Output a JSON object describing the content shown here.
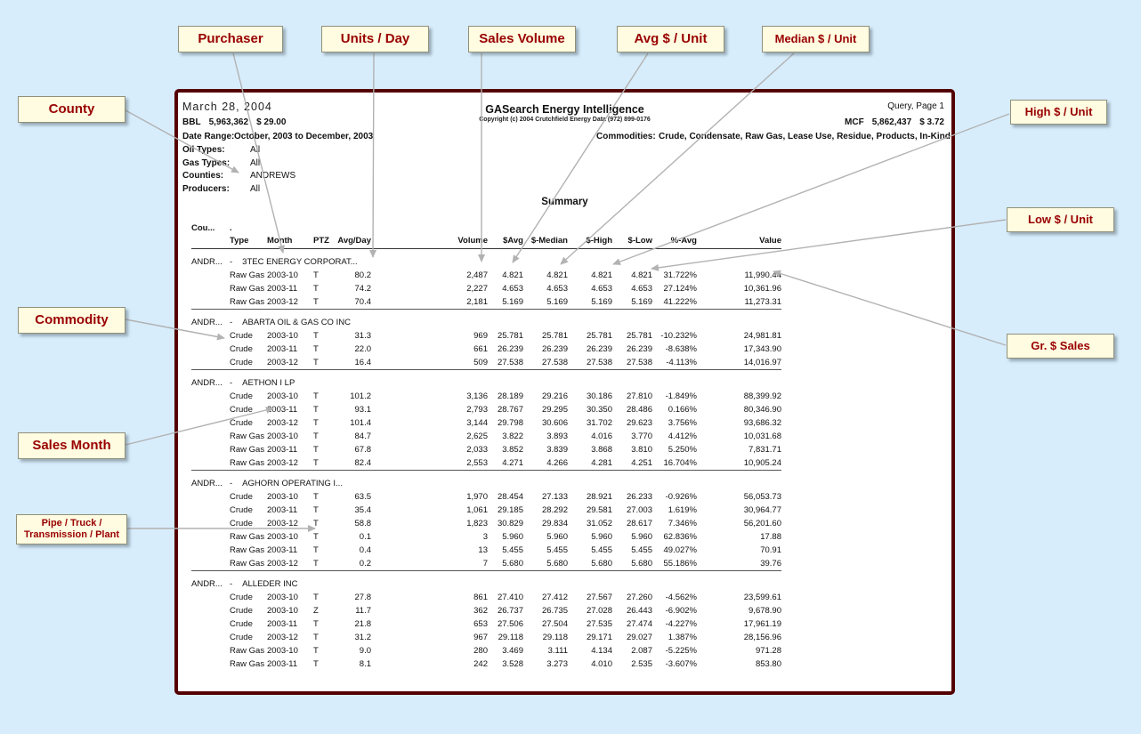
{
  "callouts": {
    "purchaser": "Purchaser",
    "units_day": "Units / Day",
    "sales_volume": "Sales Volume",
    "avg_unit": "Avg $ / Unit",
    "median_unit": "Median $ / Unit",
    "county": "County",
    "high_unit": "High $ / Unit",
    "low_unit": "Low $ / Unit",
    "commodity": "Commodity",
    "gr_sales": "Gr. $ Sales",
    "sales_month": "Sales Month",
    "ptz": "Pipe / Truck / Transmission / Plant"
  },
  "report": {
    "date": "March 28, 2004",
    "bbl": {
      "label": "BBL",
      "volume": "5,963,362",
      "price": "$ 29.00"
    },
    "mcf": {
      "label": "MCF",
      "volume": "5,862,437",
      "price": "$ 3.72"
    },
    "title": "GASearch Energy Intelligence",
    "copyright": "Copyright (c) 2004 Crutchfield Energy Data  (972) 899-0176",
    "query_page": "Query, Page 1",
    "date_range_label": "Date Range:",
    "date_range_value": "October, 2003 to December, 2003",
    "commodities_label": "Commodities:",
    "commodities_value": "Crude, Condensate, Raw Gas, Lease Use, Residue, Products, In-Kind",
    "filters": [
      {
        "label": "Oil Types:",
        "value": "All"
      },
      {
        "label": "Gas Types:",
        "value": "All"
      },
      {
        "label": "Counties:",
        "value": "ANDREWS"
      },
      {
        "label": "Producers:",
        "value": "All"
      }
    ],
    "section_title": "Summary"
  },
  "table": {
    "county_header": "Cou...",
    "dot": ".",
    "columns": [
      "Type",
      "Month",
      "PTZ",
      "Avg/Day",
      "Volume",
      "$Avg",
      "$-Median",
      "$-High",
      "$-Low",
      "%-Avg",
      "Value"
    ],
    "groups": [
      {
        "county": "ANDR...",
        "sep": "-",
        "purchaser": "3TEC ENERGY CORPORAT...",
        "rows": [
          [
            "Raw Gas",
            "2003-10",
            "T",
            "80.2",
            "2,487",
            "4.821",
            "4.821",
            "4.821",
            "4.821",
            "31.722%",
            "11,990.44"
          ],
          [
            "Raw Gas",
            "2003-11",
            "T",
            "74.2",
            "2,227",
            "4.653",
            "4.653",
            "4.653",
            "4.653",
            "27.124%",
            "10,361.96"
          ],
          [
            "Raw Gas",
            "2003-12",
            "T",
            "70.4",
            "2,181",
            "5.169",
            "5.169",
            "5.169",
            "5.169",
            "41.222%",
            "11,273.31"
          ]
        ]
      },
      {
        "county": "ANDR...",
        "sep": "-",
        "purchaser": "ABARTA OIL & GAS CO INC",
        "rows": [
          [
            "Crude",
            "2003-10",
            "T",
            "31.3",
            "969",
            "25.781",
            "25.781",
            "25.781",
            "25.781",
            "-10.232%",
            "24,981.81"
          ],
          [
            "Crude",
            "2003-11",
            "T",
            "22.0",
            "661",
            "26.239",
            "26.239",
            "26.239",
            "26.239",
            "-8.638%",
            "17,343.90"
          ],
          [
            "Crude",
            "2003-12",
            "T",
            "16.4",
            "509",
            "27.538",
            "27.538",
            "27.538",
            "27.538",
            "-4.113%",
            "14,016.97"
          ]
        ]
      },
      {
        "county": "ANDR...",
        "sep": "-",
        "purchaser": "AETHON I LP",
        "rows": [
          [
            "Crude",
            "2003-10",
            "T",
            "101.2",
            "3,136",
            "28.189",
            "29.216",
            "30.186",
            "27.810",
            "-1.849%",
            "88,399.92"
          ],
          [
            "Crude",
            "2003-11",
            "T",
            "93.1",
            "2,793",
            "28.767",
            "29.295",
            "30.350",
            "28.486",
            "0.166%",
            "80,346.90"
          ],
          [
            "Crude",
            "2003-12",
            "T",
            "101.4",
            "3,144",
            "29.798",
            "30.606",
            "31.702",
            "29.623",
            "3.756%",
            "93,686.32"
          ],
          [
            "Raw Gas",
            "2003-10",
            "T",
            "84.7",
            "2,625",
            "3.822",
            "3.893",
            "4.016",
            "3.770",
            "4.412%",
            "10,031.68"
          ],
          [
            "Raw Gas",
            "2003-11",
            "T",
            "67.8",
            "2,033",
            "3.852",
            "3.839",
            "3.868",
            "3.810",
            "5.250%",
            "7,831.71"
          ],
          [
            "Raw Gas",
            "2003-12",
            "T",
            "82.4",
            "2,553",
            "4.271",
            "4.266",
            "4.281",
            "4.251",
            "16.704%",
            "10,905.24"
          ]
        ]
      },
      {
        "county": "ANDR...",
        "sep": "-",
        "purchaser": "AGHORN OPERATING I...",
        "rows": [
          [
            "Crude",
            "2003-10",
            "T",
            "63.5",
            "1,970",
            "28.454",
            "27.133",
            "28.921",
            "26.233",
            "-0.926%",
            "56,053.73"
          ],
          [
            "Crude",
            "2003-11",
            "T",
            "35.4",
            "1,061",
            "29.185",
            "28.292",
            "29.581",
            "27.003",
            "1.619%",
            "30,964.77"
          ],
          [
            "Crude",
            "2003-12",
            "T",
            "58.8",
            "1,823",
            "30.829",
            "29.834",
            "31.052",
            "28.617",
            "7.346%",
            "56,201.60"
          ],
          [
            "Raw Gas",
            "2003-10",
            "T",
            "0.1",
            "3",
            "5.960",
            "5.960",
            "5.960",
            "5.960",
            "62.836%",
            "17.88"
          ],
          [
            "Raw Gas",
            "2003-11",
            "T",
            "0.4",
            "13",
            "5.455",
            "5.455",
            "5.455",
            "5.455",
            "49.027%",
            "70.91"
          ],
          [
            "Raw Gas",
            "2003-12",
            "T",
            "0.2",
            "7",
            "5.680",
            "5.680",
            "5.680",
            "5.680",
            "55.186%",
            "39.76"
          ]
        ]
      },
      {
        "county": "ANDR...",
        "sep": "-",
        "purchaser": "ALLEDER INC",
        "rows": [
          [
            "Crude",
            "2003-10",
            "T",
            "27.8",
            "861",
            "27.410",
            "27.412",
            "27.567",
            "27.260",
            "-4.562%",
            "23,599.61"
          ],
          [
            "Crude",
            "2003-10",
            "Z",
            "11.7",
            "362",
            "26.737",
            "26.735",
            "27.028",
            "26.443",
            "-6.902%",
            "9,678.90"
          ],
          [
            "Crude",
            "2003-11",
            "T",
            "21.8",
            "653",
            "27.506",
            "27.504",
            "27.535",
            "27.474",
            "-4.227%",
            "17,961.19"
          ],
          [
            "Crude",
            "2003-12",
            "T",
            "31.2",
            "967",
            "29.118",
            "29.118",
            "29.171",
            "29.027",
            "1.387%",
            "28,156.96"
          ],
          [
            "Raw Gas",
            "2003-10",
            "T",
            "9.0",
            "280",
            "3.469",
            "3.111",
            "4.134",
            "2.087",
            "-5.225%",
            "971.28"
          ],
          [
            "Raw Gas",
            "2003-11",
            "T",
            "8.1",
            "242",
            "3.528",
            "3.273",
            "4.010",
            "2.535",
            "-3.607%",
            "853.80"
          ]
        ]
      }
    ]
  }
}
